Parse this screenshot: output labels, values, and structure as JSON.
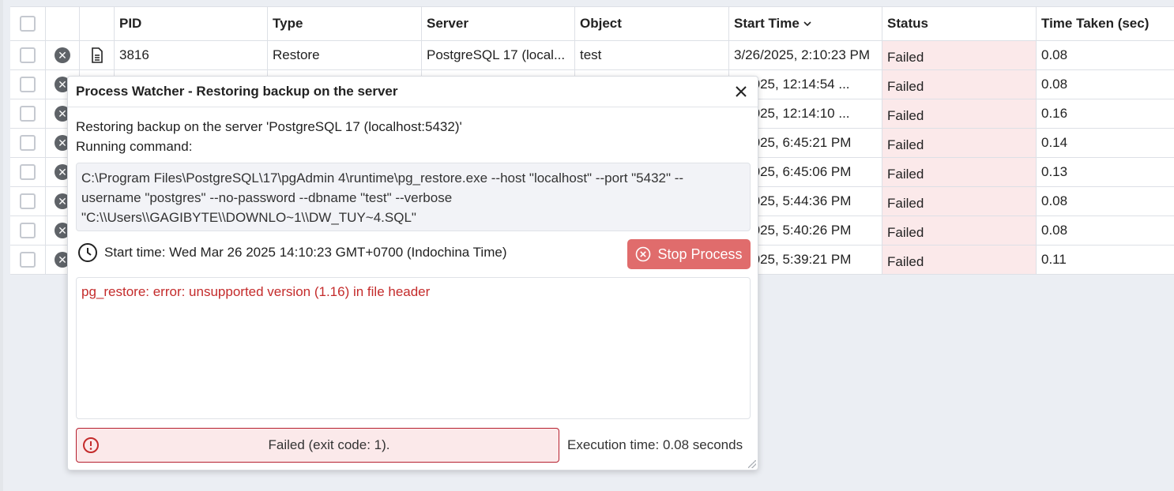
{
  "table": {
    "columns": [
      "",
      "",
      "",
      "PID",
      "Type",
      "Server",
      "Object",
      "Start Time",
      "Status",
      "Time Taken (sec)"
    ],
    "rows": [
      {
        "pid": "3816",
        "type": "Restore",
        "server": "PostgreSQL 17 (local...",
        "object": "test",
        "start": "3/26/2025, 2:10:23 PM",
        "status": "Failed",
        "time": "0.08"
      },
      {
        "pid": "",
        "type": "",
        "server": "",
        "object": "",
        "start": "4/2025, 12:14:54 ...",
        "status": "Failed",
        "time": "0.08"
      },
      {
        "pid": "",
        "type": "",
        "server": "",
        "object": "",
        "start": "4/2025, 12:14:10 ...",
        "status": "Failed",
        "time": "0.16"
      },
      {
        "pid": "",
        "type": "",
        "server": "",
        "object": "",
        "start": "3/2025, 6:45:21 PM",
        "status": "Failed",
        "time": "0.14"
      },
      {
        "pid": "",
        "type": "",
        "server": "",
        "object": "",
        "start": "3/2025, 6:45:06 PM",
        "status": "Failed",
        "time": "0.13"
      },
      {
        "pid": "",
        "type": "",
        "server": "",
        "object": "",
        "start": "3/2025, 5:44:36 PM",
        "status": "Failed",
        "time": "0.08"
      },
      {
        "pid": "",
        "type": "",
        "server": "",
        "object": "",
        "start": "3/2025, 5:40:26 PM",
        "status": "Failed",
        "time": "0.08"
      },
      {
        "pid": "",
        "type": "",
        "server": "",
        "object": "",
        "start": "3/2025, 5:39:21 PM",
        "status": "Failed",
        "time": "0.11"
      }
    ]
  },
  "modal": {
    "title": "Process Watcher - Restoring backup on the server",
    "description_line1": "Restoring backup on the server 'PostgreSQL 17 (localhost:5432)'",
    "description_line2": "Running command:",
    "command_line1": "C:\\Program Files\\PostgreSQL\\17\\pgAdmin 4\\runtime\\pg_restore.exe --host \"localhost\" --port \"5432\" --",
    "command_line2": "username \"postgres\" --no-password --dbname \"test\" --verbose",
    "command_line3": "\"C:\\\\Users\\\\GAGIBYTE\\\\DOWNLO~1\\\\DW_TUY~4.SQL\"",
    "start_time": "Start time: Wed Mar 26 2025 14:10:23 GMT+0700 (Indochina Time)",
    "stop_label": "Stop Process",
    "log_line": "pg_restore: error: unsupported version (1.16) in file header",
    "status_text": "Failed (exit code: 1).",
    "exec_time": "Execution time: 0.08 seconds"
  },
  "icons": {
    "cancel": "cancel-circle-icon",
    "log": "document-icon",
    "sort": "chevron-down-icon",
    "close": "close-icon",
    "clock": "clock-icon",
    "stop": "stop-circle-icon",
    "alert": "alert-circle-icon"
  },
  "colors": {
    "danger": "#e06c6c",
    "error_text": "#c42b2b",
    "failed_bg": "#fbe9ea",
    "error_border": "#b61f2e"
  }
}
